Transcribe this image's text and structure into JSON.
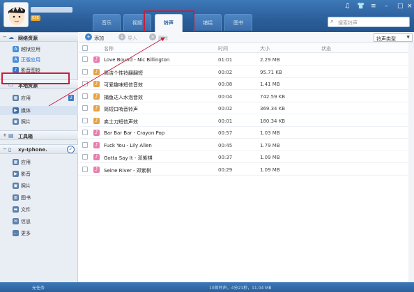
{
  "header": {
    "vip_badge": "EXE",
    "tabs": [
      {
        "label": "音乐"
      },
      {
        "label": "视频"
      },
      {
        "label": "铃声"
      },
      {
        "label": "铺铝"
      },
      {
        "label": "图书"
      }
    ],
    "search_placeholder": "搜索铃声",
    "accent": "#2b5f9b",
    "highlight": "#c81e3a"
  },
  "sidebar": {
    "net_section": "网络资源",
    "net_items": [
      {
        "label": "越狱应用",
        "icon": "app-store-icon"
      },
      {
        "label": "正版应用",
        "icon": "app-store-icon"
      },
      {
        "label": "影音图铃",
        "icon": "music-icon"
      }
    ],
    "local_section": "本地资源",
    "local_items": [
      {
        "label": "应用",
        "badge": "2",
        "icon": "grid-icon"
      },
      {
        "label": "媒体",
        "icon": "media-icon"
      },
      {
        "label": "照片",
        "icon": "photo-icon"
      }
    ],
    "toolbox_section": "工具箱",
    "device_section": "xy-Iphone.",
    "device_items": [
      {
        "label": "应用"
      },
      {
        "label": "影音"
      },
      {
        "label": "照片"
      },
      {
        "label": "图书"
      },
      {
        "label": "文件"
      },
      {
        "label": "信息"
      },
      {
        "label": "更多"
      }
    ]
  },
  "toolbar": {
    "add": "添加",
    "import": "导入",
    "delete": "删除",
    "ringtone_type": "铃声类型"
  },
  "table": {
    "headers": {
      "name": "名称",
      "time": "时间",
      "size": "大小",
      "status": "状态"
    },
    "rows": [
      {
        "name": "Love Bound - Nic Billington",
        "time": "01:01",
        "size": "2.29 MB",
        "color": "pink"
      },
      {
        "name": "简洁个性铃翻翻短",
        "time": "00:02",
        "size": "95.71 KB",
        "color": "orange"
      },
      {
        "name": "可爱趣味短信音效",
        "time": "00:08",
        "size": "1.41 MB",
        "color": "orange"
      },
      {
        "name": "捕鱼达人水泡音效",
        "time": "00:04",
        "size": "742.59 KB",
        "color": "orange"
      },
      {
        "name": "简短口哨音铃声",
        "time": "00:02",
        "size": "369.34 KB",
        "color": "orange"
      },
      {
        "name": "卖士刀短信声效",
        "time": "00:01",
        "size": "180.34 KB",
        "color": "orange"
      },
      {
        "name": "Bar Bar Bar - Crayon Pop",
        "time": "00:57",
        "size": "1.03 MB",
        "color": "pink"
      },
      {
        "name": "Fuck You - Lily Allen",
        "time": "00:45",
        "size": "1.79 MB",
        "color": "pink"
      },
      {
        "name": "Gotta Say It - 邓紫棋",
        "time": "00:37",
        "size": "1.09 MB",
        "color": "pink"
      },
      {
        "name": "Seine River - 邓紫棋",
        "time": "00:29",
        "size": "1.09 MB",
        "color": "pink"
      }
    ]
  },
  "status_bar": {
    "left": "无任务",
    "summary": "10首铃声，4分21秒，11.04 MB"
  }
}
